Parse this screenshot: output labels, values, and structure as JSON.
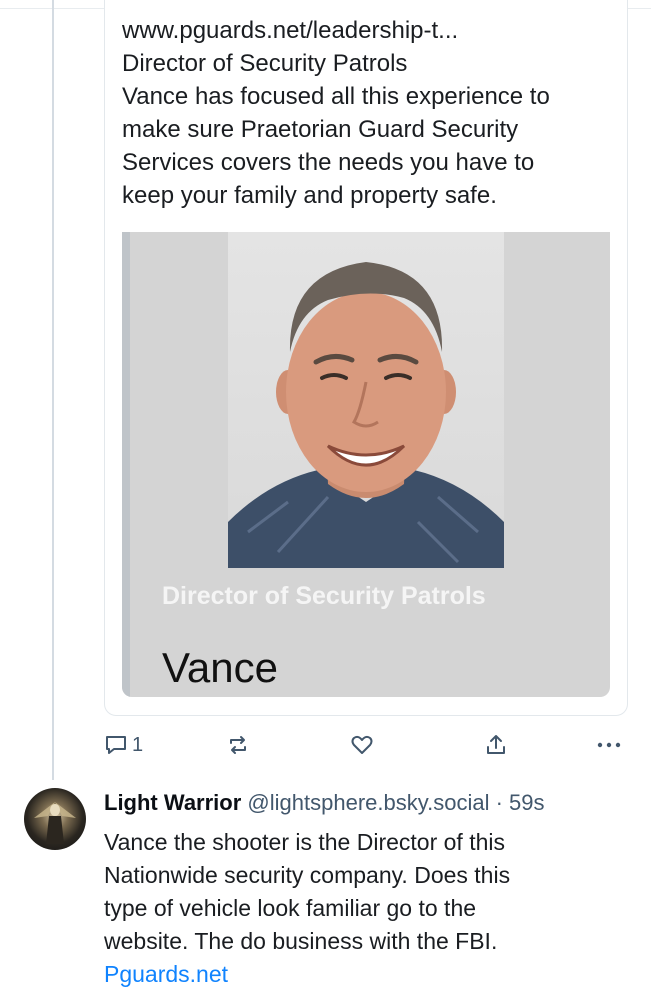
{
  "quoted_post": {
    "lines": [
      "www.pguards.net/leadership-t...",
      "Director of Security Patrols",
      "Vance has focused all this experience to",
      "make sure Praetorian Guard Security",
      "Services covers the needs you have to",
      "keep your family and property safe."
    ],
    "embed": {
      "caption": "Director of Security Patrols",
      "name": "Vance",
      "photo_alt": "smiling man portrait"
    }
  },
  "actions": {
    "reply_icon": "reply-icon",
    "reply_count": "1",
    "repost_icon": "repost-icon",
    "like_icon": "heart-icon",
    "share_icon": "share-icon",
    "more_icon": "more-icon"
  },
  "reply_post": {
    "author_name": "Light Warrior",
    "author_handle": "@lightsphere.bsky.social",
    "separator": "·",
    "time": "59s",
    "body_lines": [
      "Vance the shooter is the Director of this",
      "Nationwide security company. Does this",
      "type of vehicle look familiar go to the",
      "website. The do business with the FBI."
    ],
    "link": "Pguards.net"
  },
  "colors": {
    "accent": "#1083fe",
    "muted": "#42576c",
    "border": "#e3e8ec"
  }
}
